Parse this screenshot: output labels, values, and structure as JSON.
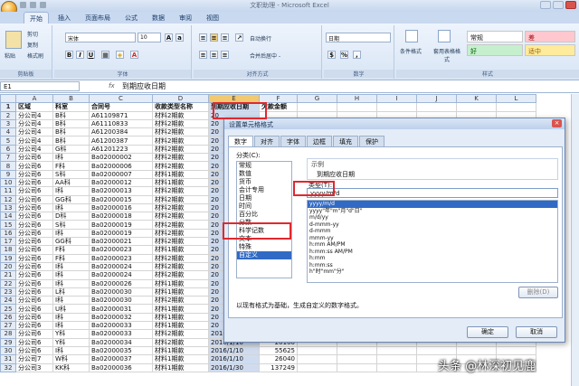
{
  "window": {
    "title": "文职助理 - Microsoft Excel"
  },
  "ribbon": {
    "tabs": [
      "开始",
      "插入",
      "页面布局",
      "公式",
      "数据",
      "审阅",
      "视图"
    ],
    "active_tab": "开始",
    "clipboard": {
      "paste": "粘贴",
      "cut": "剪切",
      "copy": "复制",
      "format_painter": "格式刷",
      "group": "剪贴板"
    },
    "font": {
      "name": "宋体",
      "size": "10",
      "group": "字体"
    },
    "alignment": {
      "wrap": "自动换行",
      "merge": "合并后居中 -",
      "group": "对齐方式"
    },
    "number": {
      "format": "日期",
      "group": "数字"
    },
    "styles": {
      "conditional": "条件格式",
      "table": "套用表格格式",
      "normal": "常规",
      "bad": "差",
      "good": "好",
      "neutral": "适中",
      "group": "样式"
    }
  },
  "formula_bar": {
    "name_box": "E1",
    "fx": "fx",
    "content": "到期应收日期"
  },
  "sheet": {
    "columns": [
      "A",
      "B",
      "C",
      "D",
      "E",
      "F",
      "G",
      "H",
      "I",
      "J",
      "K",
      "L"
    ],
    "header_row": [
      "区域",
      "科室",
      "合同号",
      "收款类型名称",
      "到期应收日期",
      "欠款金额"
    ],
    "rows": [
      [
        "分公司4",
        "B科",
        "A61109871",
        "材料2期款",
        "20",
        ""
      ],
      [
        "分公司4",
        "B科",
        "A61110833",
        "材料2期款",
        "20",
        ""
      ],
      [
        "分公司4",
        "B科",
        "A61200384",
        "材料2期款",
        "20",
        ""
      ],
      [
        "分公司4",
        "B科",
        "A61200387",
        "材料2期款",
        "20",
        ""
      ],
      [
        "分公司4",
        "G科",
        "A61201223",
        "材料2期款",
        "20",
        ""
      ],
      [
        "分公司6",
        "I科",
        "Ba02000002",
        "材料2期款",
        "20",
        ""
      ],
      [
        "分公司6",
        "F科",
        "Ba02000006",
        "材料2期款",
        "20",
        ""
      ],
      [
        "分公司6",
        "S科",
        "Ba02000007",
        "材料1期款",
        "20",
        ""
      ],
      [
        "分公司6",
        "AA科",
        "Ba02000012",
        "材料1期款",
        "20",
        ""
      ],
      [
        "分公司6",
        "I科",
        "Ba02000013",
        "材料2期款",
        "20",
        ""
      ],
      [
        "分公司6",
        "GG科",
        "Ba02000015",
        "材料2期款",
        "20",
        ""
      ],
      [
        "分公司6",
        "I科",
        "Ba02000016",
        "材料2期款",
        "20",
        ""
      ],
      [
        "分公司6",
        "D科",
        "Ba02000018",
        "材料2期款",
        "20",
        ""
      ],
      [
        "分公司6",
        "S科",
        "Ba02000019",
        "材料2期款",
        "20",
        ""
      ],
      [
        "分公司6",
        "I科",
        "Ba02000019",
        "材料2期款",
        "20",
        ""
      ],
      [
        "分公司6",
        "GG科",
        "Ba02000021",
        "材料2期款",
        "20",
        ""
      ],
      [
        "分公司6",
        "F科",
        "Ba02000023",
        "材料1期款",
        "20",
        ""
      ],
      [
        "分公司6",
        "F科",
        "Ba02000023",
        "材料2期款",
        "20",
        ""
      ],
      [
        "分公司6",
        "I科",
        "Ba02000024",
        "材料2期款",
        "20",
        ""
      ],
      [
        "分公司6",
        "I科",
        "Ba02000024",
        "材料2期款",
        "20",
        ""
      ],
      [
        "分公司6",
        "I科",
        "Ba02000026",
        "材料1期款",
        "20",
        ""
      ],
      [
        "分公司6",
        "L科",
        "Ba02000030",
        "材料1期款",
        "20",
        ""
      ],
      [
        "分公司6",
        "I科",
        "Ba02000030",
        "材料2期款",
        "20",
        ""
      ],
      [
        "分公司6",
        "U科",
        "Ba02000031",
        "材料1期款",
        "20",
        ""
      ],
      [
        "分公司6",
        "I科",
        "Ba02000032",
        "材料1期款",
        "20",
        ""
      ],
      [
        "分公司6",
        "I科",
        "Ba02000033",
        "材料1期款",
        "20",
        ""
      ],
      [
        "分公司6",
        "Y科",
        "Ba02000033",
        "材料2期款",
        "2016/1/10",
        "29949"
      ],
      [
        "分公司6",
        "Y科",
        "Ba02000034",
        "材料2期款",
        "2016/1/10",
        "20100"
      ],
      [
        "分公司6",
        "I科",
        "Ba02000035",
        "材料1期款",
        "2016/1/10",
        "55625"
      ],
      [
        "分公司7",
        "W科",
        "Ba02000037",
        "材料1期款",
        "2016/1/10",
        "26040"
      ],
      [
        "分公司3",
        "KK科",
        "Ba02000036",
        "材料1期款",
        "2016/1/30",
        "137249"
      ]
    ]
  },
  "dialog": {
    "title": "设置单元格格式",
    "tabs": [
      "数字",
      "对齐",
      "字体",
      "边框",
      "填充",
      "保护"
    ],
    "category_label": "分类(C):",
    "categories": [
      "常规",
      "数值",
      "货币",
      "会计专用",
      "日期",
      "时间",
      "百分比",
      "分数",
      "科学记数",
      "文本",
      "特殊",
      "自定义"
    ],
    "selected_category": "自定义",
    "sample_label": "示例",
    "sample_value": "到期应收日期",
    "type_label": "类型(T):",
    "type_value": "yyyy/m/d",
    "formats": [
      "yyyy/m/d",
      "yyyy\"年\"m\"月\"d\"日\"",
      "m/d/yy",
      "d-mmm-yy",
      "d-mmm",
      "mmm-yy",
      "h:mm AM/PM",
      "h:mm:ss AM/PM",
      "h:mm",
      "h:mm:ss",
      "h\"时\"mm\"分\""
    ],
    "delete_button": "删除(D)",
    "description": "以现有格式为基础，生成自定义的数字格式。",
    "ok": "确定",
    "cancel": "取消"
  },
  "watermark": "头条 @林深初见鹿"
}
